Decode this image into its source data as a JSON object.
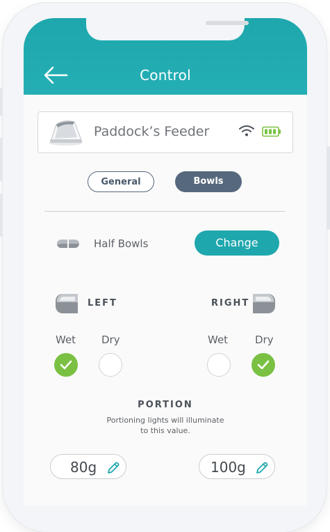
{
  "header": {
    "title": "Control"
  },
  "device": {
    "name": "Paddock’s Feeder"
  },
  "tabs": [
    {
      "label": "General"
    },
    {
      "label": "Bowls"
    }
  ],
  "bowl_mode": {
    "label": "Half Bowls",
    "change_label": "Change"
  },
  "left_bowl": {
    "label": "LEFT",
    "wet_label": "Wet",
    "dry_label": "Dry",
    "wet_selected": true,
    "dry_selected": false
  },
  "right_bowl": {
    "label": "RIGHT",
    "wet_label": "Wet",
    "dry_label": "Dry",
    "wet_selected": false,
    "dry_selected": true
  },
  "portion": {
    "title": "PORTION",
    "description_line1": "Portioning lights will illuminate",
    "description_line2": "to this value.",
    "left_value": "80g",
    "right_value": "100g"
  },
  "icons": {
    "back": "arrow-left-icon",
    "wifi": "wifi-icon",
    "battery": "battery-icon",
    "edit": "pencil-icon",
    "check": "check-icon"
  },
  "colors": {
    "accent": "#1ea7ad",
    "selected_green": "#7ac143",
    "segment_dark": "#56687c",
    "battery_green": "#7ac143"
  }
}
